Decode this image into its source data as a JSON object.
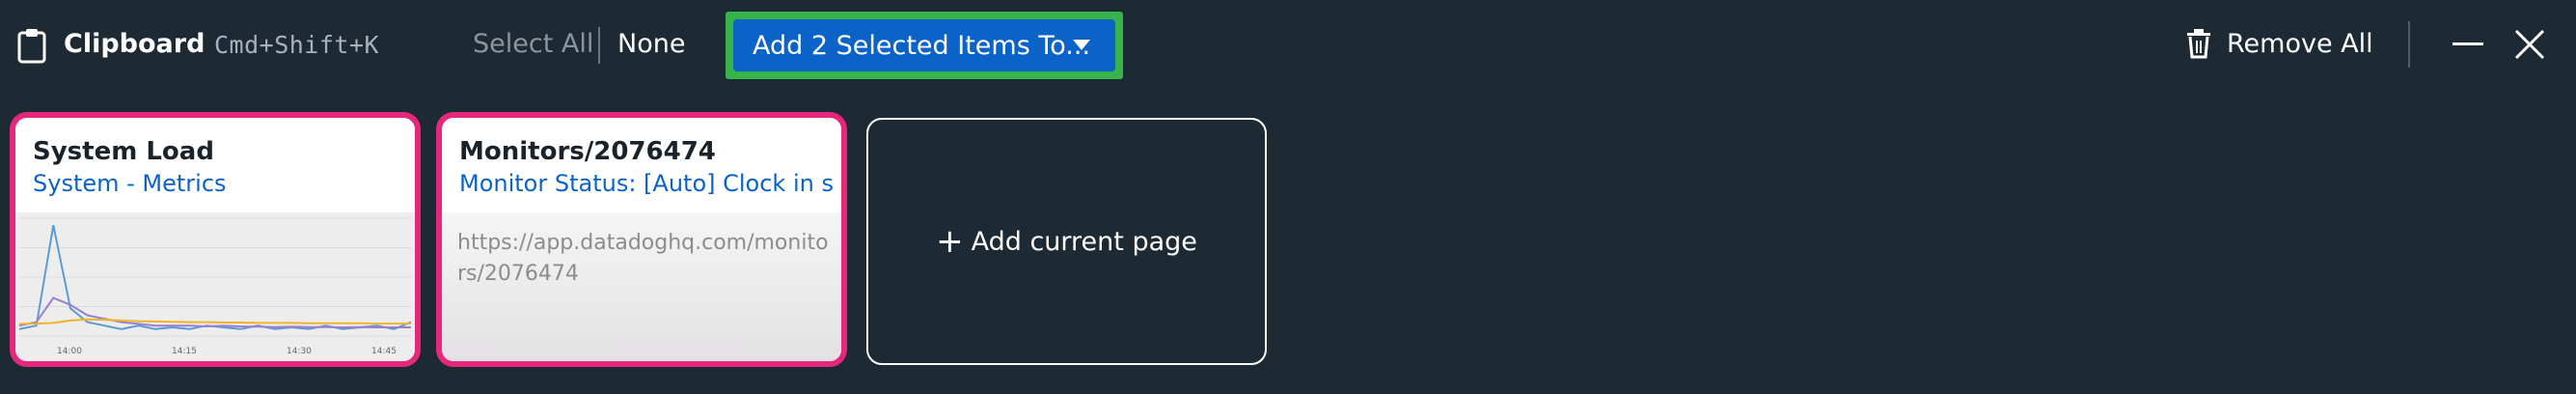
{
  "header": {
    "title": "Clipboard",
    "shortcut": "Cmd+Shift+K",
    "select_all": "Select All",
    "none": "None",
    "add_selected_button": "Add 2 Selected Items To...",
    "remove_all": "Remove All",
    "icons": [
      "clipboard-icon",
      "chevron-down-icon",
      "trash-icon",
      "minimize-icon",
      "close-icon"
    ]
  },
  "cards": [
    {
      "title": "System Load",
      "subtitle": "System - Metrics",
      "selected": true,
      "chart_data": {
        "type": "line",
        "x": [
          "14:00",
          "14:15",
          "14:30",
          "14:45"
        ],
        "series": [
          {
            "color": "#5b9bd5",
            "values": [
              0.2,
              0.3,
              3.2,
              0.8,
              0.4,
              0.3,
              0.2,
              0.3,
              0.2,
              0.25,
              0.2,
              0.3,
              0.25,
              0.2,
              0.3,
              0.2,
              0.25,
              0.2,
              0.3,
              0.2,
              0.25,
              0.3,
              0.2,
              0.4
            ]
          },
          {
            "color": "#9b7fcf",
            "values": [
              0.3,
              0.4,
              1.1,
              0.9,
              0.6,
              0.5,
              0.4,
              0.35,
              0.3,
              0.3,
              0.3,
              0.28,
              0.3,
              0.28,
              0.27,
              0.26,
              0.27,
              0.26,
              0.26,
              0.25,
              0.26,
              0.25,
              0.25,
              0.25
            ]
          },
          {
            "color": "#f0b429",
            "values": [
              0.35,
              0.36,
              0.38,
              0.45,
              0.48,
              0.47,
              0.45,
              0.43,
              0.42,
              0.41,
              0.4,
              0.4,
              0.39,
              0.39,
              0.38,
              0.38,
              0.38,
              0.37,
              0.37,
              0.37,
              0.37,
              0.36,
              0.36,
              0.36
            ]
          }
        ],
        "xlabel": "",
        "ylabel": "",
        "grid": true
      }
    },
    {
      "title": "Monitors/2076474",
      "subtitle": "Monitor Status: [Auto] Clock in s...",
      "url": "https://app.datadoghq.com/monitors/2076474",
      "selected": true
    }
  ],
  "add_current_page": {
    "plus": "+",
    "label": "Add current page"
  },
  "colors": {
    "background": "#1e2a33",
    "accent_blue": "#0b63c8",
    "focus_green": "#36b34a",
    "selection_pink": "#e6287c"
  }
}
